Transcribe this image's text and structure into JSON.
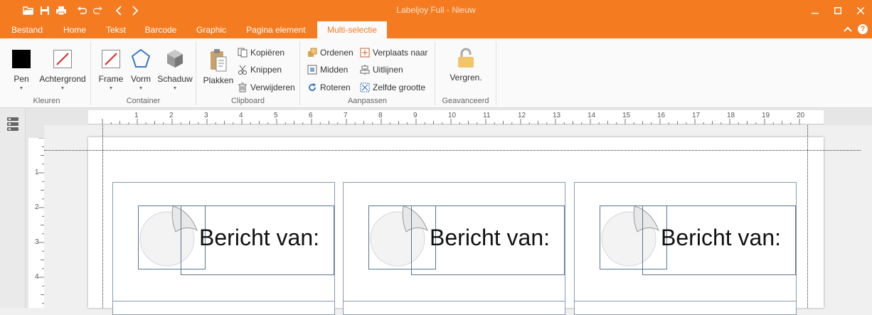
{
  "window": {
    "title": "Labeljoy Full - Nieuw"
  },
  "tabs": [
    "Bestand",
    "Home",
    "Tekst",
    "Barcode",
    "Graphic",
    "Pagina element",
    "Multi-selectie"
  ],
  "active_tab": "Multi-selectie",
  "ribbon": {
    "kleuren": {
      "label": "Kleuren",
      "pen": "Pen",
      "achtergrond": "Achtergrond"
    },
    "container": {
      "label": "Container",
      "frame": "Frame",
      "vorm": "Vorm",
      "schaduw": "Schaduw"
    },
    "clipboard": {
      "label": "Clipboard",
      "plakken": "Plakken",
      "kopieren": "Kopiëren",
      "knippen": "Knippen",
      "verwijderen": "Verwijderen"
    },
    "aanpassen": {
      "label": "Aanpassen",
      "ordenen": "Ordenen",
      "midden": "Midden",
      "roteren": "Roteren",
      "verplaats": "Verplaats naar",
      "uitlijnen": "Uitlijnen",
      "zelfde": "Zelfde grootte"
    },
    "geavanceerd": {
      "label": "Geavanceerd",
      "vergren": "Vergren."
    }
  },
  "ruler": {
    "h_numbers": [
      "1",
      "2",
      "3",
      "4",
      "5",
      "6",
      "7",
      "8",
      "9",
      "10",
      "11",
      "12",
      "13",
      "14",
      "15",
      "16",
      "17",
      "18",
      "19",
      "20"
    ],
    "v_numbers": [
      "1",
      "2",
      "3",
      "4"
    ]
  },
  "labels": [
    {
      "text": "Bericht van:"
    },
    {
      "text": "Bericht van:"
    },
    {
      "text": "Bericht van:"
    }
  ],
  "colors": {
    "accent": "#f47b20",
    "pen": "#000000",
    "background_pen": "#e03030"
  }
}
